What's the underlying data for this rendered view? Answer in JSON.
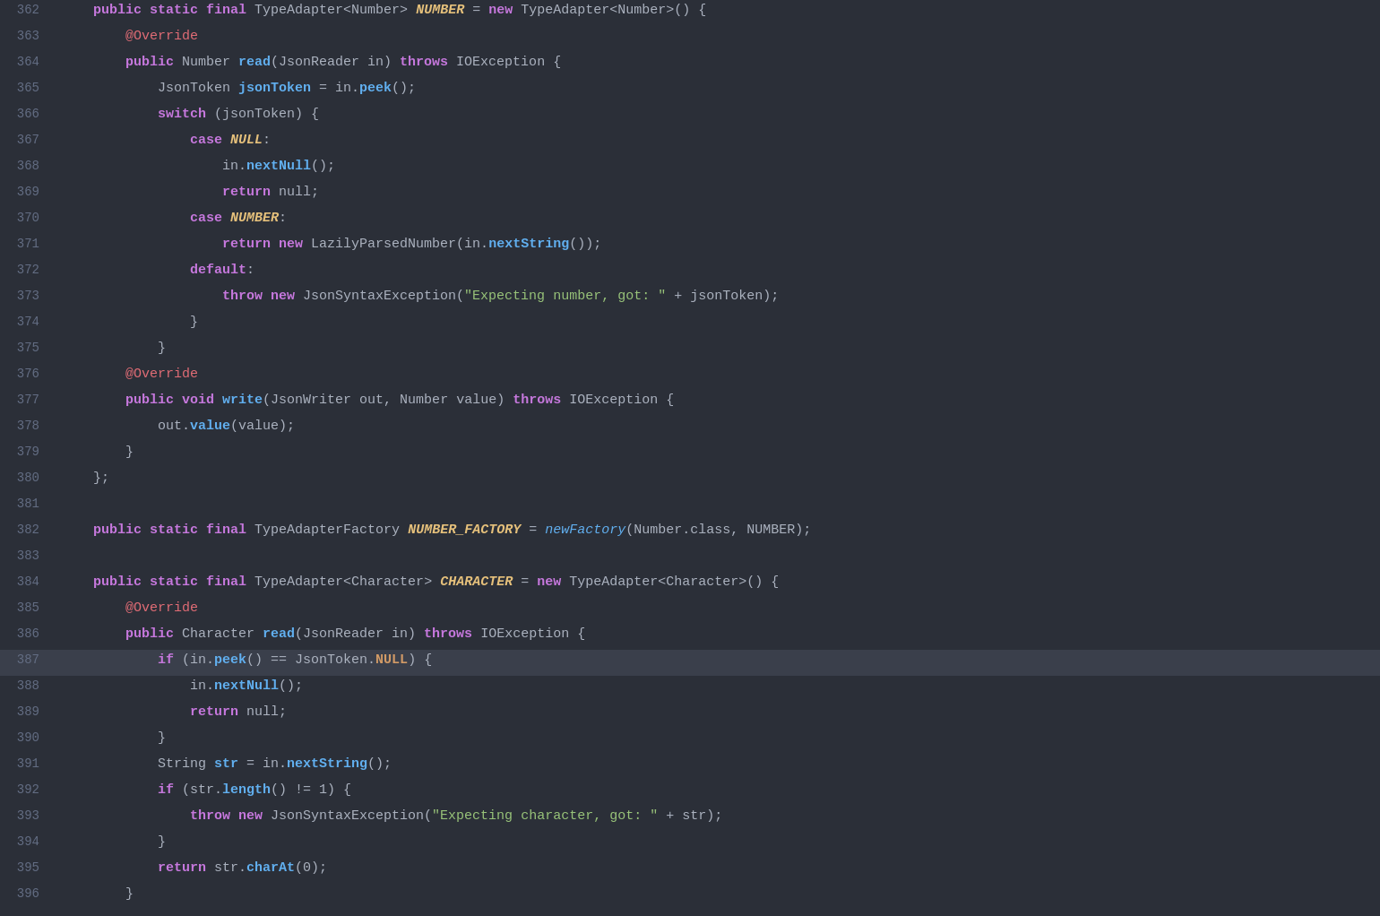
{
  "editor": {
    "background": "#2b2f38",
    "highlight_line": 387,
    "lines": [
      {
        "num": 362,
        "tokens": [
          {
            "t": "    ",
            "cls": "plain"
          },
          {
            "t": "public",
            "cls": "kw"
          },
          {
            "t": " ",
            "cls": "plain"
          },
          {
            "t": "static",
            "cls": "kw"
          },
          {
            "t": " ",
            "cls": "plain"
          },
          {
            "t": "final",
            "cls": "kw"
          },
          {
            "t": " TypeAdapter<Number> ",
            "cls": "plain"
          },
          {
            "t": "NUMBER",
            "cls": "italic-bold"
          },
          {
            "t": " = ",
            "cls": "plain"
          },
          {
            "t": "new",
            "cls": "kw"
          },
          {
            "t": " TypeAdapter<Number>() {",
            "cls": "plain"
          }
        ]
      },
      {
        "num": 363,
        "tokens": [
          {
            "t": "        ",
            "cls": "plain"
          },
          {
            "t": "@Override",
            "cls": "annot"
          }
        ]
      },
      {
        "num": 364,
        "tokens": [
          {
            "t": "        ",
            "cls": "plain"
          },
          {
            "t": "public",
            "cls": "kw"
          },
          {
            "t": " Number ",
            "cls": "plain"
          },
          {
            "t": "read",
            "cls": "fn"
          },
          {
            "t": "(JsonReader in) ",
            "cls": "plain"
          },
          {
            "t": "throws",
            "cls": "throws-kw"
          },
          {
            "t": " IOException {",
            "cls": "plain"
          }
        ]
      },
      {
        "num": 365,
        "tokens": [
          {
            "t": "            ",
            "cls": "plain"
          },
          {
            "t": "JsonToken ",
            "cls": "plain"
          },
          {
            "t": "jsonToken",
            "cls": "fn"
          },
          {
            "t": " = in.",
            "cls": "plain"
          },
          {
            "t": "peek",
            "cls": "fn"
          },
          {
            "t": "();",
            "cls": "plain"
          }
        ]
      },
      {
        "num": 366,
        "tokens": [
          {
            "t": "            ",
            "cls": "plain"
          },
          {
            "t": "switch",
            "cls": "kw"
          },
          {
            "t": " (jsonToken) {",
            "cls": "plain"
          }
        ]
      },
      {
        "num": 367,
        "tokens": [
          {
            "t": "                ",
            "cls": "plain"
          },
          {
            "t": "case",
            "cls": "kw"
          },
          {
            "t": " ",
            "cls": "plain"
          },
          {
            "t": "NULL",
            "cls": "italic-bold"
          },
          {
            "t": ":",
            "cls": "plain"
          }
        ]
      },
      {
        "num": 368,
        "tokens": [
          {
            "t": "                    ",
            "cls": "plain"
          },
          {
            "t": "in.",
            "cls": "plain"
          },
          {
            "t": "nextNull",
            "cls": "fn"
          },
          {
            "t": "();",
            "cls": "plain"
          }
        ]
      },
      {
        "num": 369,
        "tokens": [
          {
            "t": "                    ",
            "cls": "plain"
          },
          {
            "t": "return",
            "cls": "kw"
          },
          {
            "t": " null;",
            "cls": "plain"
          }
        ]
      },
      {
        "num": 370,
        "tokens": [
          {
            "t": "                ",
            "cls": "plain"
          },
          {
            "t": "case",
            "cls": "kw"
          },
          {
            "t": " ",
            "cls": "plain"
          },
          {
            "t": "NUMBER",
            "cls": "italic-bold"
          },
          {
            "t": ":",
            "cls": "plain"
          }
        ]
      },
      {
        "num": 371,
        "tokens": [
          {
            "t": "                    ",
            "cls": "plain"
          },
          {
            "t": "return",
            "cls": "kw"
          },
          {
            "t": " ",
            "cls": "plain"
          },
          {
            "t": "new",
            "cls": "kw"
          },
          {
            "t": " LazilyParsedNumber(in.",
            "cls": "plain"
          },
          {
            "t": "nextString",
            "cls": "fn"
          },
          {
            "t": "());",
            "cls": "plain"
          }
        ]
      },
      {
        "num": 372,
        "tokens": [
          {
            "t": "                ",
            "cls": "plain"
          },
          {
            "t": "default",
            "cls": "kw"
          },
          {
            "t": ":",
            "cls": "plain"
          }
        ]
      },
      {
        "num": 373,
        "tokens": [
          {
            "t": "                    ",
            "cls": "plain"
          },
          {
            "t": "throw",
            "cls": "kw"
          },
          {
            "t": " ",
            "cls": "plain"
          },
          {
            "t": "new",
            "cls": "kw"
          },
          {
            "t": " JsonSyntaxException(",
            "cls": "plain"
          },
          {
            "t": "\"Expecting number, got: \"",
            "cls": "str"
          },
          {
            "t": " + jsonToken);",
            "cls": "plain"
          }
        ]
      },
      {
        "num": 374,
        "tokens": [
          {
            "t": "                ",
            "cls": "plain"
          },
          {
            "t": "}",
            "cls": "plain"
          }
        ]
      },
      {
        "num": 375,
        "tokens": [
          {
            "t": "            ",
            "cls": "plain"
          },
          {
            "t": "}",
            "cls": "plain"
          }
        ]
      },
      {
        "num": 376,
        "tokens": [
          {
            "t": "        ",
            "cls": "plain"
          },
          {
            "t": "@Override",
            "cls": "annot"
          }
        ]
      },
      {
        "num": 377,
        "tokens": [
          {
            "t": "        ",
            "cls": "plain"
          },
          {
            "t": "public",
            "cls": "kw"
          },
          {
            "t": " ",
            "cls": "plain"
          },
          {
            "t": "void",
            "cls": "kw"
          },
          {
            "t": " ",
            "cls": "plain"
          },
          {
            "t": "write",
            "cls": "fn"
          },
          {
            "t": "(JsonWriter out, Number value) ",
            "cls": "plain"
          },
          {
            "t": "throws",
            "cls": "throws-kw"
          },
          {
            "t": " IOException {",
            "cls": "plain"
          }
        ]
      },
      {
        "num": 378,
        "tokens": [
          {
            "t": "            ",
            "cls": "plain"
          },
          {
            "t": "out.",
            "cls": "plain"
          },
          {
            "t": "value",
            "cls": "fn"
          },
          {
            "t": "(value);",
            "cls": "plain"
          }
        ]
      },
      {
        "num": 379,
        "tokens": [
          {
            "t": "        ",
            "cls": "plain"
          },
          {
            "t": "}",
            "cls": "plain"
          }
        ]
      },
      {
        "num": 380,
        "tokens": [
          {
            "t": "    ",
            "cls": "plain"
          },
          {
            "t": "};",
            "cls": "plain"
          }
        ]
      },
      {
        "num": 381,
        "tokens": []
      },
      {
        "num": 382,
        "tokens": [
          {
            "t": "    ",
            "cls": "plain"
          },
          {
            "t": "public",
            "cls": "kw"
          },
          {
            "t": " ",
            "cls": "plain"
          },
          {
            "t": "static",
            "cls": "kw"
          },
          {
            "t": " ",
            "cls": "plain"
          },
          {
            "t": "final",
            "cls": "kw"
          },
          {
            "t": " TypeAdapterFactory ",
            "cls": "plain"
          },
          {
            "t": "NUMBER_FACTORY",
            "cls": "italic-bold"
          },
          {
            "t": " = ",
            "cls": "plain"
          },
          {
            "t": "newFactory",
            "cls": "italic-fn"
          },
          {
            "t": "(Number.class, NUMBER);",
            "cls": "plain"
          }
        ]
      },
      {
        "num": 383,
        "tokens": []
      },
      {
        "num": 384,
        "tokens": [
          {
            "t": "    ",
            "cls": "plain"
          },
          {
            "t": "public",
            "cls": "kw"
          },
          {
            "t": " ",
            "cls": "plain"
          },
          {
            "t": "static",
            "cls": "kw"
          },
          {
            "t": " ",
            "cls": "plain"
          },
          {
            "t": "final",
            "cls": "kw"
          },
          {
            "t": " TypeAdapter<Character> ",
            "cls": "plain"
          },
          {
            "t": "CHARACTER",
            "cls": "italic-bold"
          },
          {
            "t": " = ",
            "cls": "plain"
          },
          {
            "t": "new",
            "cls": "kw"
          },
          {
            "t": " TypeAdapter<Character>() {",
            "cls": "plain"
          }
        ]
      },
      {
        "num": 385,
        "tokens": [
          {
            "t": "        ",
            "cls": "plain"
          },
          {
            "t": "@Override",
            "cls": "annot"
          }
        ]
      },
      {
        "num": 386,
        "tokens": [
          {
            "t": "        ",
            "cls": "plain"
          },
          {
            "t": "public",
            "cls": "kw"
          },
          {
            "t": " Character ",
            "cls": "plain"
          },
          {
            "t": "read",
            "cls": "fn"
          },
          {
            "t": "(JsonReader in) ",
            "cls": "plain"
          },
          {
            "t": "throws",
            "cls": "throws-kw"
          },
          {
            "t": " IOException {",
            "cls": "plain"
          }
        ]
      },
      {
        "num": 387,
        "tokens": [
          {
            "t": "            ",
            "cls": "plain"
          },
          {
            "t": "if",
            "cls": "kw"
          },
          {
            "t": " (in.",
            "cls": "plain"
          },
          {
            "t": "peek",
            "cls": "fn"
          },
          {
            "t": "() == JsonToken.",
            "cls": "plain"
          },
          {
            "t": "NULL",
            "cls": "null-kw"
          },
          {
            "t": ") {",
            "cls": "plain"
          }
        ],
        "highlighted": true
      },
      {
        "num": 388,
        "tokens": [
          {
            "t": "                ",
            "cls": "plain"
          },
          {
            "t": "in.",
            "cls": "plain"
          },
          {
            "t": "nextNull",
            "cls": "fn"
          },
          {
            "t": "();",
            "cls": "plain"
          }
        ]
      },
      {
        "num": 389,
        "tokens": [
          {
            "t": "                ",
            "cls": "plain"
          },
          {
            "t": "return",
            "cls": "kw"
          },
          {
            "t": " null;",
            "cls": "plain"
          }
        ]
      },
      {
        "num": 390,
        "tokens": [
          {
            "t": "            ",
            "cls": "plain"
          },
          {
            "t": "}",
            "cls": "plain"
          }
        ]
      },
      {
        "num": 391,
        "tokens": [
          {
            "t": "            ",
            "cls": "plain"
          },
          {
            "t": "String ",
            "cls": "plain"
          },
          {
            "t": "str",
            "cls": "fn"
          },
          {
            "t": " = in.",
            "cls": "plain"
          },
          {
            "t": "nextString",
            "cls": "fn"
          },
          {
            "t": "();",
            "cls": "plain"
          }
        ]
      },
      {
        "num": 392,
        "tokens": [
          {
            "t": "            ",
            "cls": "plain"
          },
          {
            "t": "if",
            "cls": "kw"
          },
          {
            "t": " (str.",
            "cls": "plain"
          },
          {
            "t": "length",
            "cls": "fn"
          },
          {
            "t": "() != 1) {",
            "cls": "plain"
          }
        ]
      },
      {
        "num": 393,
        "tokens": [
          {
            "t": "                ",
            "cls": "plain"
          },
          {
            "t": "throw",
            "cls": "kw"
          },
          {
            "t": " ",
            "cls": "plain"
          },
          {
            "t": "new",
            "cls": "kw"
          },
          {
            "t": " JsonSyntaxException(",
            "cls": "plain"
          },
          {
            "t": "\"Expecting character, got: \"",
            "cls": "str"
          },
          {
            "t": " + str);",
            "cls": "plain"
          }
        ]
      },
      {
        "num": 394,
        "tokens": [
          {
            "t": "            ",
            "cls": "plain"
          },
          {
            "t": "}",
            "cls": "plain"
          }
        ]
      },
      {
        "num": 395,
        "tokens": [
          {
            "t": "            ",
            "cls": "plain"
          },
          {
            "t": "return",
            "cls": "kw"
          },
          {
            "t": " str.",
            "cls": "plain"
          },
          {
            "t": "charAt",
            "cls": "fn"
          },
          {
            "t": "(0);",
            "cls": "plain"
          }
        ]
      },
      {
        "num": 396,
        "tokens": [
          {
            "t": "        ",
            "cls": "plain"
          },
          {
            "t": "}",
            "cls": "plain"
          }
        ]
      }
    ]
  }
}
